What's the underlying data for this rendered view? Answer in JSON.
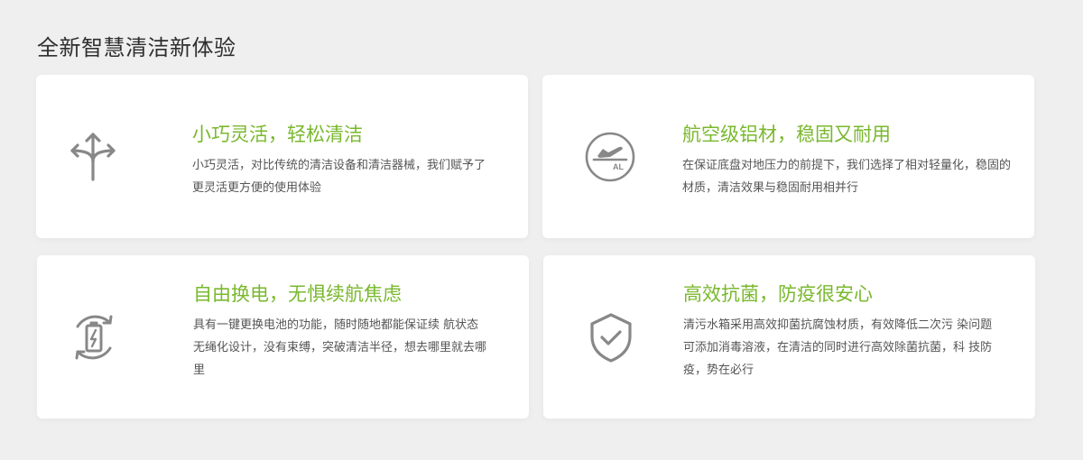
{
  "section": {
    "title": "全新智慧清洁新体验"
  },
  "colors": {
    "accent": "#7ab82e",
    "icon": "#888888",
    "background": "#efefef",
    "card": "#ffffff"
  },
  "features": [
    {
      "icon": "direction-arrows-icon",
      "title": "小巧灵活，轻松清洁",
      "desc": "小巧灵活，对比传统的清洁设备和清洁器械，我们赋予了更灵活更方便的使用体验"
    },
    {
      "icon": "airplane-al-icon",
      "title": "航空级铝材，稳固又耐用",
      "desc": "在保证底盘对地压力的前提下，我们选择了相对轻量化，稳固的材质，清洁效果与稳固耐用相并行",
      "icon_text": "AL"
    },
    {
      "icon": "battery-swap-icon",
      "title": "自由换电，无惧续航焦虑",
      "desc_lines": [
        "具有一键更换电池的功能，随时随地都能保证续 航状态",
        "无绳化设计，没有束缚，突破清洁半径，想去哪里就去哪里"
      ]
    },
    {
      "icon": "shield-check-icon",
      "title": "高效抗菌，防疫很安心",
      "desc_lines": [
        "清污水箱采用高效抑菌抗腐蚀材质，有效降低二次污 染问题",
        "可添加消毒溶液，在清洁的同时进行高效除菌抗菌，科 技防疫，势在必行"
      ]
    }
  ]
}
